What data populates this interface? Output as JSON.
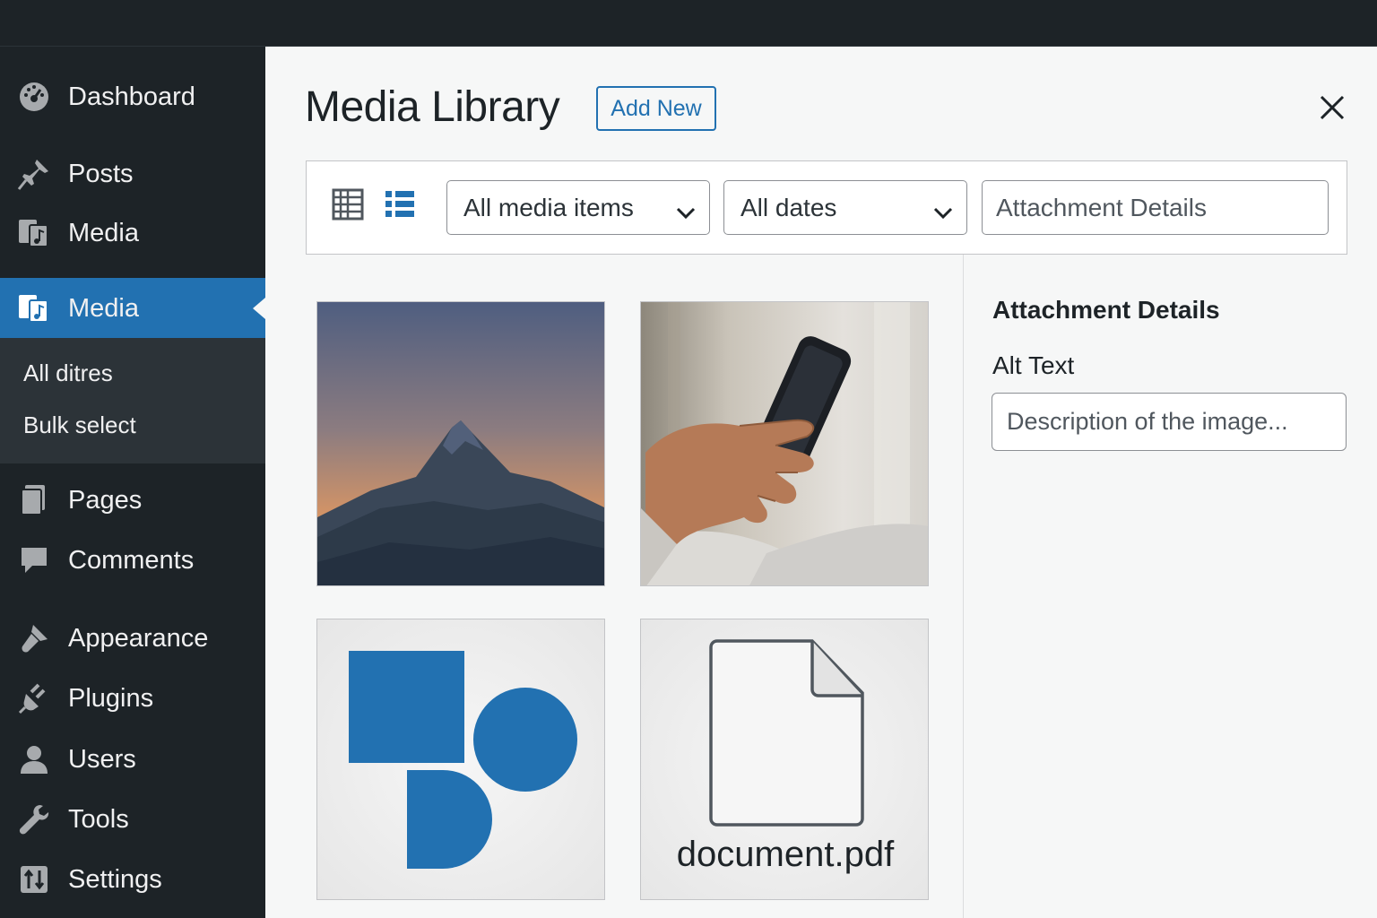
{
  "sidebar": {
    "items": [
      {
        "label": "Dashboard",
        "icon": "dashboard-icon"
      },
      {
        "label": "Posts",
        "icon": "pin-icon"
      },
      {
        "label": "Media",
        "icon": "media-icon"
      },
      {
        "label": "Media",
        "icon": "media-icon",
        "active": true
      },
      {
        "label": "Pages",
        "icon": "pages-icon"
      },
      {
        "label": "Comments",
        "icon": "comment-icon"
      },
      {
        "label": "Appearance",
        "icon": "brush-icon"
      },
      {
        "label": "Plugins",
        "icon": "plug-icon"
      },
      {
        "label": "Users",
        "icon": "user-icon"
      },
      {
        "label": "Tools",
        "icon": "wrench-icon"
      },
      {
        "label": "Settings",
        "icon": "settings-icon"
      }
    ],
    "submenu": [
      "All ditres",
      "Bulk select"
    ]
  },
  "header": {
    "title": "Media Library",
    "add_new_label": "Add New"
  },
  "toolbar": {
    "media_filter": "All media items",
    "date_filter": "All dates",
    "search_placeholder": "Attachment Details"
  },
  "grid": {
    "items": [
      {
        "type": "image",
        "subject": "mountain"
      },
      {
        "type": "image",
        "subject": "phone"
      },
      {
        "type": "image",
        "subject": "shapes"
      },
      {
        "type": "file",
        "filename": "document.pdf"
      }
    ]
  },
  "details": {
    "title": "Attachment Details",
    "alt_label": "Alt Text",
    "alt_placeholder": "Description of the image..."
  },
  "colors": {
    "accent": "#2271b1",
    "sidebar_bg": "#1d2327",
    "main_bg": "#f6f7f7"
  }
}
